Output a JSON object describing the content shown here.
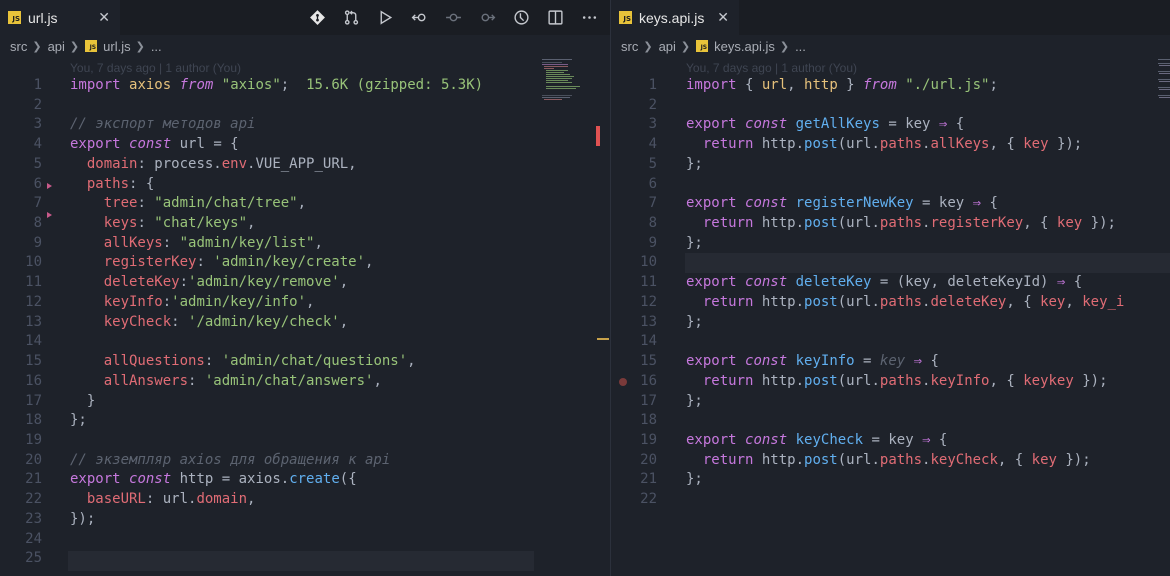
{
  "left_editor": {
    "tab": {
      "label": "url.js",
      "icon": "js-file-icon"
    },
    "breadcrumb": [
      "src",
      "api",
      "url.js",
      "..."
    ],
    "codelens": "You, 7 days ago | 1 author (You)",
    "lines": [
      {
        "n": "1",
        "t": [
          [
            "kw",
            "import"
          ],
          [
            "id",
            " "
          ],
          [
            "obj",
            "axios"
          ],
          [
            "id",
            " "
          ],
          [
            "kwi",
            "from"
          ],
          [
            "id",
            " "
          ],
          [
            "str",
            "\"axios\""
          ],
          [
            "id",
            ";  "
          ],
          [
            "size",
            "15.6K (gzipped: 5.3K)"
          ]
        ]
      },
      {
        "n": "2",
        "t": []
      },
      {
        "n": "3",
        "t": [
          [
            "cmt",
            "// экспорт методов api"
          ]
        ]
      },
      {
        "n": "4",
        "t": [
          [
            "kw",
            "export"
          ],
          [
            "id",
            " "
          ],
          [
            "kwi",
            "const"
          ],
          [
            "id",
            " url = {"
          ]
        ]
      },
      {
        "n": "5",
        "t": [
          [
            "id",
            "  "
          ],
          [
            "prop",
            "domain"
          ],
          [
            "id",
            ": process."
          ],
          [
            "prop",
            "env"
          ],
          [
            "id",
            ".VUE_APP_URL,"
          ]
        ]
      },
      {
        "n": "6",
        "t": [
          [
            "id",
            "  "
          ],
          [
            "prop",
            "paths"
          ],
          [
            "id",
            ": {"
          ]
        ]
      },
      {
        "n": "7",
        "t": [
          [
            "id",
            "    "
          ],
          [
            "prop",
            "tree"
          ],
          [
            "id",
            ": "
          ],
          [
            "str",
            "\"admin/chat/tree\""
          ],
          [
            "id",
            ","
          ]
        ]
      },
      {
        "n": "8",
        "t": [
          [
            "id",
            "    "
          ],
          [
            "prop",
            "keys"
          ],
          [
            "id",
            ": "
          ],
          [
            "str",
            "\"chat/keys\""
          ],
          [
            "id",
            ","
          ]
        ]
      },
      {
        "n": "9",
        "t": [
          [
            "id",
            "    "
          ],
          [
            "prop",
            "allKeys"
          ],
          [
            "id",
            ": "
          ],
          [
            "str",
            "\"admin/key/list\""
          ],
          [
            "id",
            ","
          ]
        ]
      },
      {
        "n": "10",
        "t": [
          [
            "id",
            "    "
          ],
          [
            "prop",
            "registerKey"
          ],
          [
            "id",
            ": "
          ],
          [
            "str",
            "'admin/key/create'"
          ],
          [
            "id",
            ","
          ]
        ]
      },
      {
        "n": "11",
        "t": [
          [
            "id",
            "    "
          ],
          [
            "prop",
            "deleteKey"
          ],
          [
            "id",
            ":"
          ],
          [
            "str",
            "'admin/key/remove'"
          ],
          [
            "id",
            ","
          ]
        ]
      },
      {
        "n": "12",
        "t": [
          [
            "id",
            "    "
          ],
          [
            "prop",
            "keyInfo"
          ],
          [
            "id",
            ":"
          ],
          [
            "str",
            "'admin/key/info'"
          ],
          [
            "id",
            ","
          ]
        ]
      },
      {
        "n": "13",
        "t": [
          [
            "id",
            "    "
          ],
          [
            "prop",
            "keyCheck"
          ],
          [
            "id",
            ": "
          ],
          [
            "str",
            "'/admin/key/check'"
          ],
          [
            "id",
            ","
          ]
        ]
      },
      {
        "n": "14",
        "t": []
      },
      {
        "n": "15",
        "t": [
          [
            "id",
            "    "
          ],
          [
            "prop",
            "allQuestions"
          ],
          [
            "id",
            ": "
          ],
          [
            "str",
            "'admin/chat/questions'"
          ],
          [
            "id",
            ","
          ]
        ]
      },
      {
        "n": "16",
        "t": [
          [
            "id",
            "    "
          ],
          [
            "prop",
            "allAnswers"
          ],
          [
            "id",
            ": "
          ],
          [
            "str",
            "'admin/chat/answers'"
          ],
          [
            "id",
            ","
          ]
        ]
      },
      {
        "n": "17",
        "t": [
          [
            "id",
            "  }"
          ]
        ]
      },
      {
        "n": "18",
        "t": [
          [
            "id",
            "};"
          ]
        ]
      },
      {
        "n": "19",
        "t": []
      },
      {
        "n": "20",
        "t": [
          [
            "cmt",
            "// экземпляр axios для обращения к api"
          ]
        ]
      },
      {
        "n": "21",
        "t": [
          [
            "kw",
            "export"
          ],
          [
            "id",
            " "
          ],
          [
            "kwi",
            "const"
          ],
          [
            "id",
            " http = axios."
          ],
          [
            "fn",
            "create"
          ],
          [
            "id",
            "({"
          ]
        ]
      },
      {
        "n": "22",
        "t": [
          [
            "id",
            "  "
          ],
          [
            "prop",
            "baseURL"
          ],
          [
            "id",
            ": url."
          ],
          [
            "prop",
            "domain"
          ],
          [
            "id",
            ","
          ]
        ]
      },
      {
        "n": "23",
        "t": [
          [
            "id",
            "});"
          ]
        ]
      },
      {
        "n": "24",
        "t": []
      },
      {
        "n": "25",
        "t": []
      }
    ]
  },
  "right_editor": {
    "tab": {
      "label": "keys.api.js",
      "icon": "js-file-icon"
    },
    "breadcrumb": [
      "src",
      "api",
      "keys.api.js",
      "..."
    ],
    "codelens": "You, 7 days ago | 1 author (You)",
    "lines": [
      {
        "n": "1",
        "t": [
          [
            "kw",
            "import"
          ],
          [
            "id",
            " { "
          ],
          [
            "obj",
            "url"
          ],
          [
            "id",
            ", "
          ],
          [
            "obj",
            "http"
          ],
          [
            "id",
            " } "
          ],
          [
            "kwi",
            "from"
          ],
          [
            "id",
            " "
          ],
          [
            "str",
            "\"./url.js\""
          ],
          [
            "id",
            ";"
          ]
        ]
      },
      {
        "n": "2",
        "t": []
      },
      {
        "n": "3",
        "t": [
          [
            "kw",
            "export"
          ],
          [
            "id",
            " "
          ],
          [
            "kwi",
            "const"
          ],
          [
            "id",
            " "
          ],
          [
            "fn",
            "getAllKeys"
          ],
          [
            "id",
            " = key "
          ],
          [
            "kw",
            "⇒"
          ],
          [
            "id",
            " {"
          ]
        ]
      },
      {
        "n": "4",
        "t": [
          [
            "id",
            "  "
          ],
          [
            "kw",
            "return"
          ],
          [
            "id",
            " http."
          ],
          [
            "fn",
            "post"
          ],
          [
            "id",
            "(url."
          ],
          [
            "prop",
            "paths"
          ],
          [
            "id",
            "."
          ],
          [
            "prop",
            "allKeys"
          ],
          [
            "id",
            ", { "
          ],
          [
            "prop",
            "key"
          ],
          [
            "id",
            " });"
          ]
        ]
      },
      {
        "n": "5",
        "t": [
          [
            "id",
            "};"
          ]
        ]
      },
      {
        "n": "6",
        "t": []
      },
      {
        "n": "7",
        "t": [
          [
            "kw",
            "export"
          ],
          [
            "id",
            " "
          ],
          [
            "kwi",
            "const"
          ],
          [
            "id",
            " "
          ],
          [
            "fn",
            "registerNewKey"
          ],
          [
            "id",
            " = key "
          ],
          [
            "kw",
            "⇒"
          ],
          [
            "id",
            " {"
          ]
        ]
      },
      {
        "n": "8",
        "t": [
          [
            "id",
            "  "
          ],
          [
            "kw",
            "return"
          ],
          [
            "id",
            " http."
          ],
          [
            "fn",
            "post"
          ],
          [
            "id",
            "(url."
          ],
          [
            "prop",
            "paths"
          ],
          [
            "id",
            "."
          ],
          [
            "prop",
            "registerKey"
          ],
          [
            "id",
            ", { "
          ],
          [
            "prop",
            "key"
          ],
          [
            "id",
            " });"
          ]
        ]
      },
      {
        "n": "9",
        "t": [
          [
            "id",
            "};"
          ]
        ]
      },
      {
        "n": "10",
        "t": []
      },
      {
        "n": "11",
        "t": [
          [
            "kw",
            "export"
          ],
          [
            "id",
            " "
          ],
          [
            "kwi",
            "const"
          ],
          [
            "id",
            " "
          ],
          [
            "fn",
            "deleteKey"
          ],
          [
            "id",
            " = (key, deleteKeyId) "
          ],
          [
            "kw",
            "⇒"
          ],
          [
            "id",
            " {"
          ]
        ]
      },
      {
        "n": "12",
        "t": [
          [
            "id",
            "  "
          ],
          [
            "kw",
            "return"
          ],
          [
            "id",
            " http."
          ],
          [
            "fn",
            "post"
          ],
          [
            "id",
            "(url."
          ],
          [
            "prop",
            "paths"
          ],
          [
            "id",
            "."
          ],
          [
            "prop",
            "deleteKey"
          ],
          [
            "id",
            ", { "
          ],
          [
            "prop",
            "key"
          ],
          [
            "id",
            ", "
          ],
          [
            "prop",
            "key_i"
          ]
        ]
      },
      {
        "n": "13",
        "t": [
          [
            "id",
            "};"
          ]
        ]
      },
      {
        "n": "14",
        "t": []
      },
      {
        "n": "15",
        "t": [
          [
            "kw",
            "export"
          ],
          [
            "id",
            " "
          ],
          [
            "kwi",
            "const"
          ],
          [
            "id",
            " "
          ],
          [
            "fn",
            "keyInfo"
          ],
          [
            "id",
            " = "
          ],
          [
            "cmt",
            "key"
          ],
          [
            "id",
            " "
          ],
          [
            "kw",
            "⇒"
          ],
          [
            "id",
            " {"
          ]
        ]
      },
      {
        "n": "16",
        "t": [
          [
            "id",
            "  "
          ],
          [
            "kw",
            "return"
          ],
          [
            "id",
            " http."
          ],
          [
            "fn",
            "post"
          ],
          [
            "id",
            "(url."
          ],
          [
            "prop",
            "paths"
          ],
          [
            "id",
            "."
          ],
          [
            "prop",
            "keyInfo"
          ],
          [
            "id",
            ", { "
          ],
          [
            "prop",
            "keykey"
          ],
          [
            "id",
            " });"
          ]
        ]
      },
      {
        "n": "17",
        "t": [
          [
            "id",
            "};"
          ]
        ]
      },
      {
        "n": "18",
        "t": []
      },
      {
        "n": "19",
        "t": [
          [
            "kw",
            "export"
          ],
          [
            "id",
            " "
          ],
          [
            "kwi",
            "const"
          ],
          [
            "id",
            " "
          ],
          [
            "fn",
            "keyCheck"
          ],
          [
            "id",
            " = key "
          ],
          [
            "kw",
            "⇒"
          ],
          [
            "id",
            " {"
          ]
        ]
      },
      {
        "n": "20",
        "t": [
          [
            "id",
            "  "
          ],
          [
            "kw",
            "return"
          ],
          [
            "id",
            " http."
          ],
          [
            "fn",
            "post"
          ],
          [
            "id",
            "(url."
          ],
          [
            "prop",
            "paths"
          ],
          [
            "id",
            "."
          ],
          [
            "prop",
            "keyCheck"
          ],
          [
            "id",
            ", { "
          ],
          [
            "prop",
            "key"
          ],
          [
            "id",
            " });"
          ]
        ]
      },
      {
        "n": "21",
        "t": [
          [
            "id",
            "};"
          ]
        ]
      },
      {
        "n": "22",
        "t": []
      }
    ]
  },
  "toolbar": {
    "icons": [
      "source-control-icon",
      "compare-changes-icon",
      "run-icon",
      "previous-change-icon",
      "commit-icon",
      "next-change-icon",
      "timeline-icon",
      "split-editor-icon",
      "more-actions-icon"
    ]
  },
  "colors": {
    "keyword": "#c678dd",
    "function": "#61afef",
    "string": "#98c379",
    "property": "#e06c75",
    "comment": "#5c6370",
    "background": "#1e222a"
  }
}
